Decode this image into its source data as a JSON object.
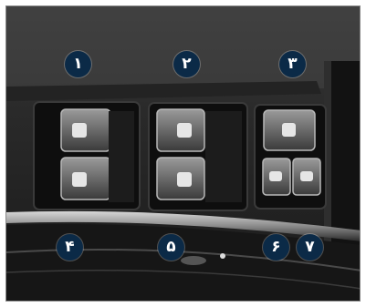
{
  "photo": {
    "subject": "door-window-switch-panel",
    "colors": {
      "callout_bg": "#0b2a47",
      "callout_text": "#ffffff",
      "panel_dark": "#141414"
    }
  },
  "callouts": [
    {
      "id": "1",
      "label": "۱",
      "points_to": "front-left-window-switch"
    },
    {
      "id": "2",
      "label": "۲",
      "points_to": "front-right-window-switch"
    },
    {
      "id": "3",
      "label": "۳",
      "points_to": "window-lock-switch"
    },
    {
      "id": "4",
      "label": "۴",
      "points_to": "rear-left-window-switch"
    },
    {
      "id": "5",
      "label": "۵",
      "points_to": "rear-right-window-switch"
    },
    {
      "id": "6",
      "label": "۶",
      "points_to": "left-mirror-fold-switch"
    },
    {
      "id": "7",
      "label": "۷",
      "points_to": "right-mirror-fold-switch"
    }
  ]
}
